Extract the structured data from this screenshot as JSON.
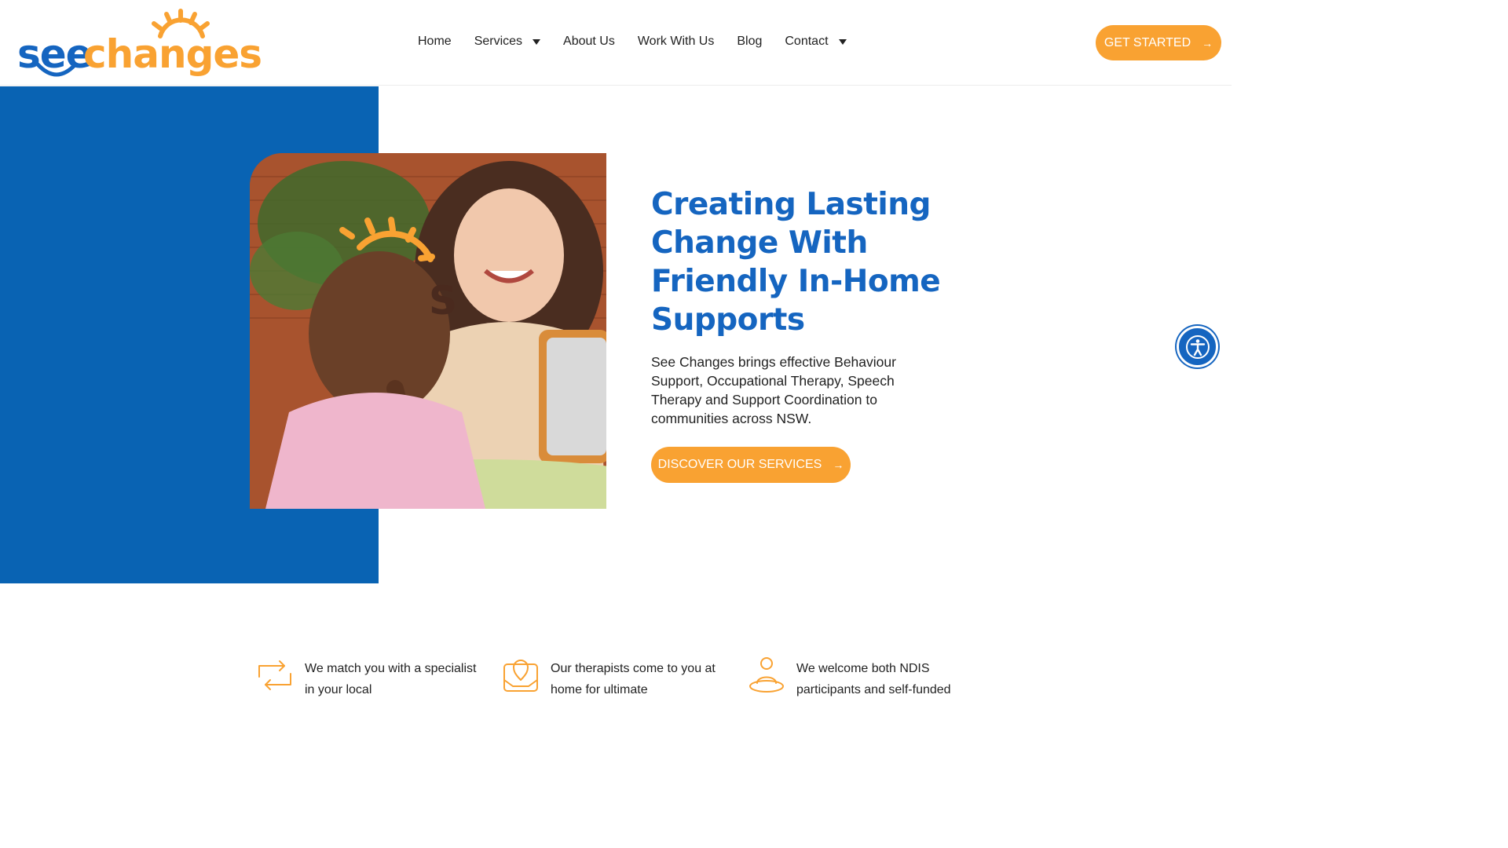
{
  "brand": {
    "logo_see": "see",
    "logo_changes": "changes",
    "primary_color": "#1565c0",
    "accent_color": "#f9a232"
  },
  "nav": {
    "items": [
      {
        "label": "Home",
        "has_dropdown": false
      },
      {
        "label": "Services",
        "has_dropdown": true
      },
      {
        "label": "About Us",
        "has_dropdown": false
      },
      {
        "label": "Work With Us",
        "has_dropdown": false
      },
      {
        "label": "Blog",
        "has_dropdown": false
      },
      {
        "label": "Contact",
        "has_dropdown": true
      }
    ],
    "cta_label": "GET STARTED",
    "cta_arrow": "→"
  },
  "hero": {
    "title": "Creating Lasting Change With Friendly In-Home Supports",
    "description": "See Changes brings effective Behaviour Support, Occupational Therapy, Speech Therapy and Support Coordination to communities across NSW.",
    "button_label": "DISCOVER OUR SERVICES",
    "button_arrow": "→",
    "photo_letter": "S"
  },
  "features": [
    {
      "icon": "swap-arrows-icon",
      "text": "We match you with a specialist in your local"
    },
    {
      "icon": "home-location-icon",
      "text": "Our therapists come to you at home for ultimate"
    },
    {
      "icon": "person-icon",
      "text": "We welcome both NDIS participants and self-funded"
    }
  ]
}
